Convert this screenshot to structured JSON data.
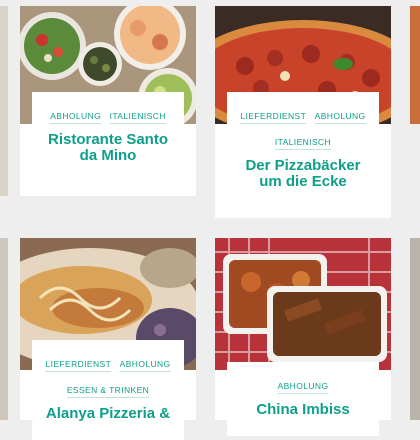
{
  "cards": [
    {
      "title": "Ristorante Santo da Mino",
      "tags": [
        "ABHOLUNG",
        "ITALIENISCH"
      ]
    },
    {
      "title": "Der Pizzabäcker um die Ecke",
      "tags": [
        "LIEFERDIENST",
        "ABHOLUNG",
        "ITALIENISCH"
      ]
    },
    {
      "title": "Alanya Pizzeria &",
      "tags": [
        "LIEFERDIENST",
        "ABHOLUNG",
        "ESSEN & TRINKEN"
      ]
    },
    {
      "title": "China Imbiss",
      "tags": [
        "ABHOLUNG"
      ]
    }
  ],
  "colors": {
    "accent": "#0e9f8a",
    "background": "#eeeeee"
  }
}
